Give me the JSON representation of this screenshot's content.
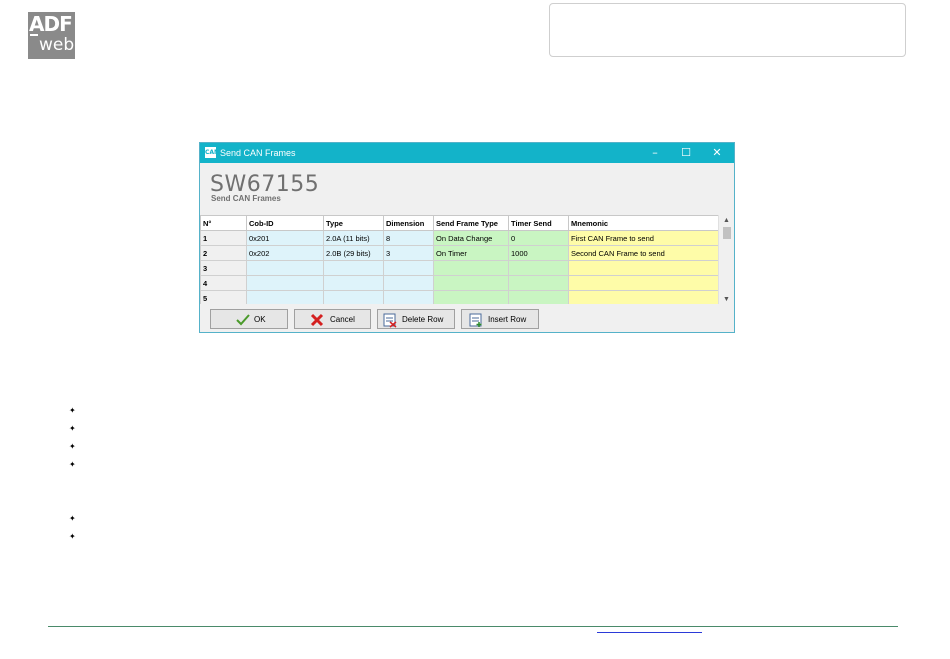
{
  "logo": {
    "top": "ADF",
    "bottom": "web"
  },
  "window": {
    "title": "Send CAN Frames",
    "controls": {
      "minimize": "–",
      "maximize": "☐",
      "close": "✕"
    },
    "banner_title": "SW67155",
    "banner_subtitle": "Send CAN Frames"
  },
  "table": {
    "columns": [
      "N°",
      "Cob-ID",
      "Type",
      "Dimension",
      "Send Frame Type",
      "Timer Send",
      "Mnemonic"
    ],
    "rows": [
      [
        "1",
        "0x201",
        "2.0A (11 bits)",
        "8",
        "On Data Change",
        "0",
        "First CAN Frame to send"
      ],
      [
        "2",
        "0x202",
        "2.0B (29 bits)",
        "3",
        "On Timer",
        "1000",
        "Second CAN Frame to send"
      ],
      [
        "3",
        "",
        "",
        "",
        "",
        "",
        ""
      ],
      [
        "4",
        "",
        "",
        "",
        "",
        "",
        ""
      ],
      [
        "5",
        "",
        "",
        "",
        "",
        "",
        ""
      ]
    ]
  },
  "buttons": {
    "ok": "OK",
    "cancel": "Cancel",
    "delete_row": "Delete Row",
    "insert_row": "Insert Row"
  },
  "colors": {
    "titlebar": "#13b3c9",
    "cell_blue": "#def3fa",
    "cell_green": "#c9f5c2",
    "cell_yellow": "#fefca8"
  }
}
